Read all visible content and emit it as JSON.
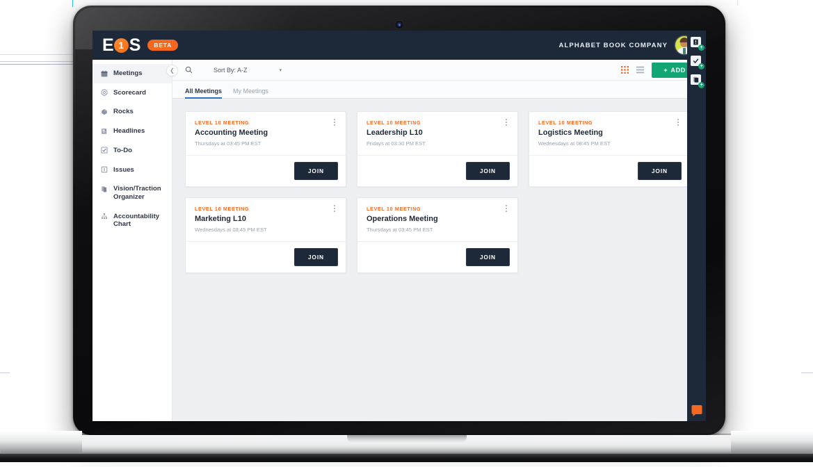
{
  "app": {
    "logo_left": "E",
    "logo_center": "1",
    "logo_right": "S",
    "beta_label": "BETA",
    "company_name": "ALPHABET BOOK COMPANY"
  },
  "sidebar": {
    "items": [
      {
        "label": "Meetings",
        "icon": "calendar-icon",
        "active": true
      },
      {
        "label": "Scorecard",
        "icon": "target-icon",
        "active": false
      },
      {
        "label": "Rocks",
        "icon": "rock-icon",
        "active": false
      },
      {
        "label": "Headlines",
        "icon": "newspaper-icon",
        "active": false
      },
      {
        "label": "To-Do",
        "icon": "checkbox-icon",
        "active": false
      },
      {
        "label": "Issues",
        "icon": "list-icon",
        "active": false
      },
      {
        "label": "Vision/Traction Organizer",
        "icon": "documents-icon",
        "active": false
      },
      {
        "label": "Accountability Chart",
        "icon": "org-chart-icon",
        "active": false
      }
    ]
  },
  "toolbar": {
    "collapse_icon": "chevron-left-icon",
    "search_icon": "search-icon",
    "sort_label": "Sort By: A-Z",
    "sort_caret": "▾",
    "grid_view_icon": "grid-view-icon",
    "list_view_icon": "list-view-icon",
    "add_label": "ADD",
    "add_plus": "+"
  },
  "tabs": [
    {
      "label": "All Meetings",
      "active": true
    },
    {
      "label": "My Meetings",
      "active": false
    }
  ],
  "cards": [
    {
      "tag": "LEVEL 10 MEETING",
      "title": "Accounting Meeting",
      "schedule": "Thursdays at 03:45 PM EST",
      "join_label": "JOIN"
    },
    {
      "tag": "LEVEL 10 MEETING",
      "title": "Leadership L10",
      "schedule": "Fridays at 03:30 PM EST",
      "join_label": "JOIN"
    },
    {
      "tag": "LEVEL 10 MEETING",
      "title": "Logistics Meeting",
      "schedule": "Wednesdays at 08:45 PM EST",
      "join_label": "JOIN"
    },
    {
      "tag": "LEVEL 10 MEETING",
      "title": "Marketing L10",
      "schedule": "Wednesdays at 03:45 PM EST",
      "join_label": "JOIN"
    },
    {
      "tag": "LEVEL 10 MEETING",
      "title": "Operations Meeting",
      "schedule": "Thursdays at 03:45 PM EST",
      "join_label": "JOIN"
    }
  ],
  "right_rail": {
    "items": [
      {
        "icon": "add-issue-icon",
        "badge": "+"
      },
      {
        "icon": "add-todo-icon",
        "badge": "+"
      },
      {
        "icon": "add-headline-icon",
        "badge": "+"
      }
    ],
    "chat_icon": "chat-bubble-icon"
  },
  "colors": {
    "header_navy": "#1d2838",
    "accent_orange": "#f4691f",
    "accent_green": "#13a675",
    "tab_blue": "#2a72c4",
    "canvas": "#eef0f3"
  }
}
